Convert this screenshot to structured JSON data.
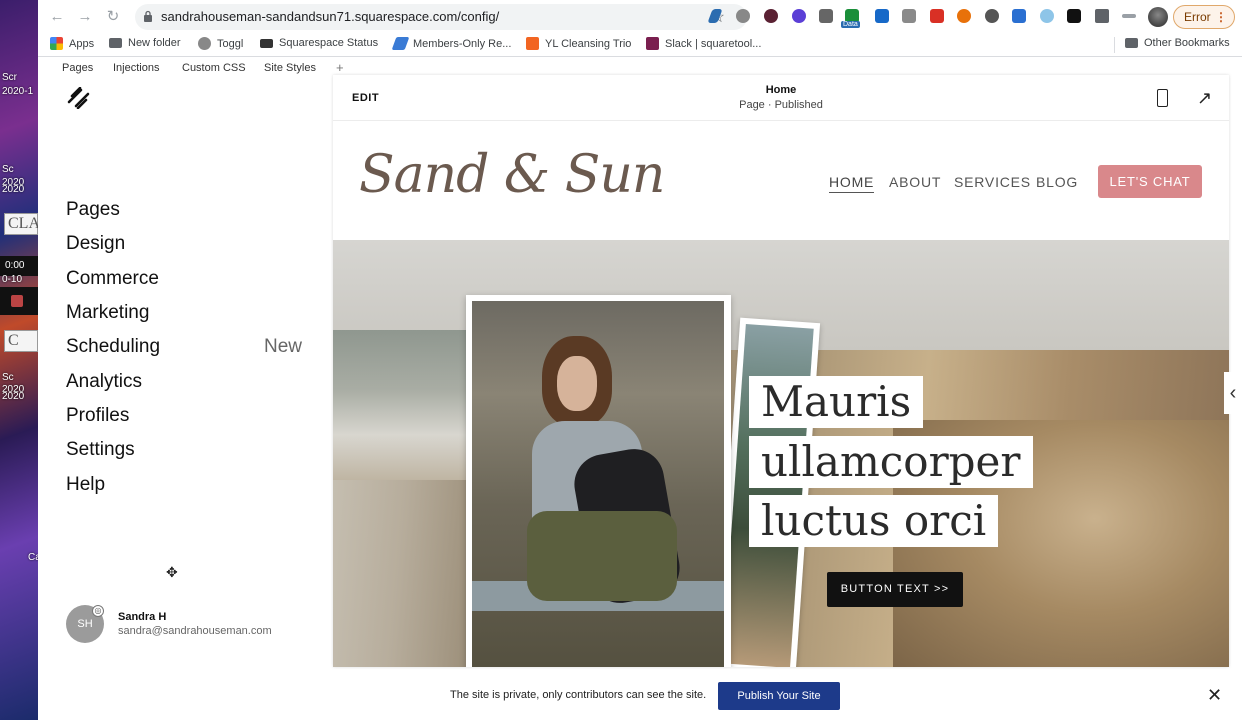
{
  "desktop": {
    "labels": [
      "Scr",
      "2020-1",
      "Sc",
      "2020",
      "2020",
      "0:00",
      "0-10",
      "Sc",
      "2020",
      "2020",
      "Ca"
    ],
    "box_text_1": "CLA",
    "box_text_2": "C"
  },
  "browser": {
    "url": "sandrahouseman-sandandsun71.squarespace.com/config/",
    "error_label": "Error",
    "data_badge": "Data",
    "bookmarks": [
      {
        "label": "Apps"
      },
      {
        "label": "New folder"
      },
      {
        "label": "Toggl"
      },
      {
        "label": "Squarespace Status"
      },
      {
        "label": "Members-Only Re..."
      },
      {
        "label": "YL Cleansing Trio"
      },
      {
        "label": "Slack | squaretool..."
      }
    ],
    "other_bookmarks": "Other Bookmarks"
  },
  "ss_tabs": [
    "Pages",
    "Injections",
    "Custom CSS",
    "Site Styles",
    "+"
  ],
  "sidebar": {
    "items": [
      {
        "label": "Pages"
      },
      {
        "label": "Design"
      },
      {
        "label": "Commerce"
      },
      {
        "label": "Marketing"
      },
      {
        "label": "Scheduling"
      },
      {
        "label": "Analytics"
      },
      {
        "label": "Profiles"
      },
      {
        "label": "Settings"
      },
      {
        "label": "Help"
      }
    ],
    "new_badge": "New"
  },
  "user": {
    "initials": "SH",
    "name": "Sandra H",
    "email": "sandra@sandrahouseman.com"
  },
  "preview": {
    "edit_label": "EDIT",
    "page_name": "Home",
    "page_status": "Page · Published"
  },
  "site": {
    "logo": "Sand & Sun",
    "nav": [
      {
        "label": "HOME",
        "active": true
      },
      {
        "label": "ABOUT"
      },
      {
        "label": "SERVICES"
      },
      {
        "label": "BLOG"
      }
    ],
    "cta": "LET'S CHAT",
    "headline": [
      "Mauris",
      "ullamcorper",
      "luctus orci"
    ],
    "hero_button": "BUTTON TEXT >>"
  },
  "banner": {
    "text": "The site is private, only contributors can see the site.",
    "publish": "Publish Your Site"
  },
  "colors": {
    "cta": "#d9888b",
    "publish": "#1d3a8a",
    "logo": "#6b5a4f"
  }
}
